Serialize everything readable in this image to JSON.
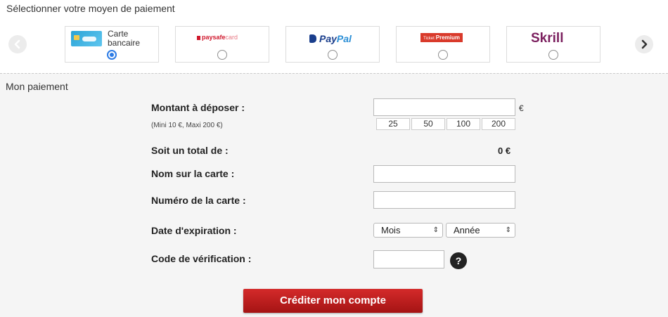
{
  "header": {
    "title": "Sélectionner votre moyen de paiement"
  },
  "methods": {
    "card": {
      "label": "Carte bancaire",
      "selected": true
    },
    "paysafecard": {
      "brand_main": "paysafe",
      "brand_light": "card",
      "selected": false
    },
    "paypal": {
      "brand_main": "Pay",
      "brand_light": "Pal",
      "selected": false
    },
    "premium": {
      "brand_small": "Ticket",
      "brand_main": "Premium",
      "selected": false
    },
    "skrill": {
      "brand": "Skrill",
      "selected": false
    }
  },
  "icons": {
    "prev": "chevron-left-icon",
    "next": "chevron-right-icon",
    "help": "question-icon"
  },
  "payment": {
    "section_title": "Mon paiement",
    "amount_label": "Montant à déposer :",
    "amount_hint": "(Mini 10 €, Maxi 200 €)",
    "amount_value": "",
    "currency": "€",
    "presets": [
      "25",
      "50",
      "100",
      "200"
    ],
    "total_label": "Soit un total de :",
    "total_value": "0 €",
    "name_label": "Nom sur la carte :",
    "name_value": "",
    "number_label": "Numéro de la carte :",
    "number_value": "",
    "expiry_label": "Date d'expiration :",
    "month_select": "Mois",
    "year_select": "Année",
    "cvv_label": "Code de vérification :",
    "cvv_value": "",
    "help_symbol": "?",
    "submit_label": "Créditer mon compte"
  },
  "colors": {
    "accent": "#2c7be5",
    "submit": "#c41e1e",
    "skrill": "#7b1f5e",
    "paypal": "#1a3e8c"
  }
}
